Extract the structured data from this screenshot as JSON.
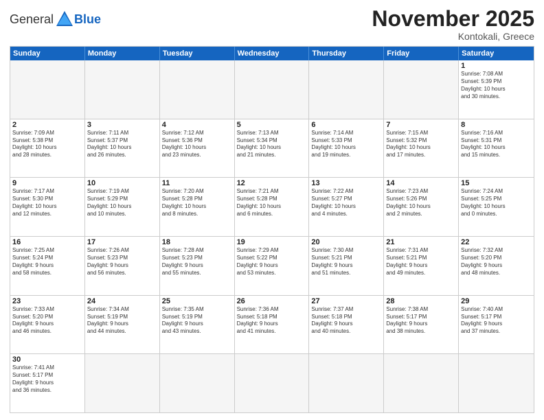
{
  "header": {
    "logo_general": "General",
    "logo_blue": "Blue",
    "month_title": "November 2025",
    "location": "Kontokali, Greece"
  },
  "days_of_week": [
    "Sunday",
    "Monday",
    "Tuesday",
    "Wednesday",
    "Thursday",
    "Friday",
    "Saturday"
  ],
  "weeks": [
    [
      {
        "day": "",
        "info": ""
      },
      {
        "day": "",
        "info": ""
      },
      {
        "day": "",
        "info": ""
      },
      {
        "day": "",
        "info": ""
      },
      {
        "day": "",
        "info": ""
      },
      {
        "day": "",
        "info": ""
      },
      {
        "day": "1",
        "info": "Sunrise: 7:08 AM\nSunset: 5:39 PM\nDaylight: 10 hours\nand 30 minutes."
      }
    ],
    [
      {
        "day": "2",
        "info": "Sunrise: 7:09 AM\nSunset: 5:38 PM\nDaylight: 10 hours\nand 28 minutes."
      },
      {
        "day": "3",
        "info": "Sunrise: 7:11 AM\nSunset: 5:37 PM\nDaylight: 10 hours\nand 26 minutes."
      },
      {
        "day": "4",
        "info": "Sunrise: 7:12 AM\nSunset: 5:36 PM\nDaylight: 10 hours\nand 23 minutes."
      },
      {
        "day": "5",
        "info": "Sunrise: 7:13 AM\nSunset: 5:34 PM\nDaylight: 10 hours\nand 21 minutes."
      },
      {
        "day": "6",
        "info": "Sunrise: 7:14 AM\nSunset: 5:33 PM\nDaylight: 10 hours\nand 19 minutes."
      },
      {
        "day": "7",
        "info": "Sunrise: 7:15 AM\nSunset: 5:32 PM\nDaylight: 10 hours\nand 17 minutes."
      },
      {
        "day": "8",
        "info": "Sunrise: 7:16 AM\nSunset: 5:31 PM\nDaylight: 10 hours\nand 15 minutes."
      }
    ],
    [
      {
        "day": "9",
        "info": "Sunrise: 7:17 AM\nSunset: 5:30 PM\nDaylight: 10 hours\nand 12 minutes."
      },
      {
        "day": "10",
        "info": "Sunrise: 7:19 AM\nSunset: 5:29 PM\nDaylight: 10 hours\nand 10 minutes."
      },
      {
        "day": "11",
        "info": "Sunrise: 7:20 AM\nSunset: 5:28 PM\nDaylight: 10 hours\nand 8 minutes."
      },
      {
        "day": "12",
        "info": "Sunrise: 7:21 AM\nSunset: 5:28 PM\nDaylight: 10 hours\nand 6 minutes."
      },
      {
        "day": "13",
        "info": "Sunrise: 7:22 AM\nSunset: 5:27 PM\nDaylight: 10 hours\nand 4 minutes."
      },
      {
        "day": "14",
        "info": "Sunrise: 7:23 AM\nSunset: 5:26 PM\nDaylight: 10 hours\nand 2 minutes."
      },
      {
        "day": "15",
        "info": "Sunrise: 7:24 AM\nSunset: 5:25 PM\nDaylight: 10 hours\nand 0 minutes."
      }
    ],
    [
      {
        "day": "16",
        "info": "Sunrise: 7:25 AM\nSunset: 5:24 PM\nDaylight: 9 hours\nand 58 minutes."
      },
      {
        "day": "17",
        "info": "Sunrise: 7:26 AM\nSunset: 5:23 PM\nDaylight: 9 hours\nand 56 minutes."
      },
      {
        "day": "18",
        "info": "Sunrise: 7:28 AM\nSunset: 5:23 PM\nDaylight: 9 hours\nand 55 minutes."
      },
      {
        "day": "19",
        "info": "Sunrise: 7:29 AM\nSunset: 5:22 PM\nDaylight: 9 hours\nand 53 minutes."
      },
      {
        "day": "20",
        "info": "Sunrise: 7:30 AM\nSunset: 5:21 PM\nDaylight: 9 hours\nand 51 minutes."
      },
      {
        "day": "21",
        "info": "Sunrise: 7:31 AM\nSunset: 5:21 PM\nDaylight: 9 hours\nand 49 minutes."
      },
      {
        "day": "22",
        "info": "Sunrise: 7:32 AM\nSunset: 5:20 PM\nDaylight: 9 hours\nand 48 minutes."
      }
    ],
    [
      {
        "day": "23",
        "info": "Sunrise: 7:33 AM\nSunset: 5:20 PM\nDaylight: 9 hours\nand 46 minutes."
      },
      {
        "day": "24",
        "info": "Sunrise: 7:34 AM\nSunset: 5:19 PM\nDaylight: 9 hours\nand 44 minutes."
      },
      {
        "day": "25",
        "info": "Sunrise: 7:35 AM\nSunset: 5:19 PM\nDaylight: 9 hours\nand 43 minutes."
      },
      {
        "day": "26",
        "info": "Sunrise: 7:36 AM\nSunset: 5:18 PM\nDaylight: 9 hours\nand 41 minutes."
      },
      {
        "day": "27",
        "info": "Sunrise: 7:37 AM\nSunset: 5:18 PM\nDaylight: 9 hours\nand 40 minutes."
      },
      {
        "day": "28",
        "info": "Sunrise: 7:38 AM\nSunset: 5:17 PM\nDaylight: 9 hours\nand 38 minutes."
      },
      {
        "day": "29",
        "info": "Sunrise: 7:40 AM\nSunset: 5:17 PM\nDaylight: 9 hours\nand 37 minutes."
      }
    ],
    [
      {
        "day": "30",
        "info": "Sunrise: 7:41 AM\nSunset: 5:17 PM\nDaylight: 9 hours\nand 36 minutes."
      },
      {
        "day": "",
        "info": ""
      },
      {
        "day": "",
        "info": ""
      },
      {
        "day": "",
        "info": ""
      },
      {
        "day": "",
        "info": ""
      },
      {
        "day": "",
        "info": ""
      },
      {
        "day": "",
        "info": ""
      }
    ]
  ]
}
